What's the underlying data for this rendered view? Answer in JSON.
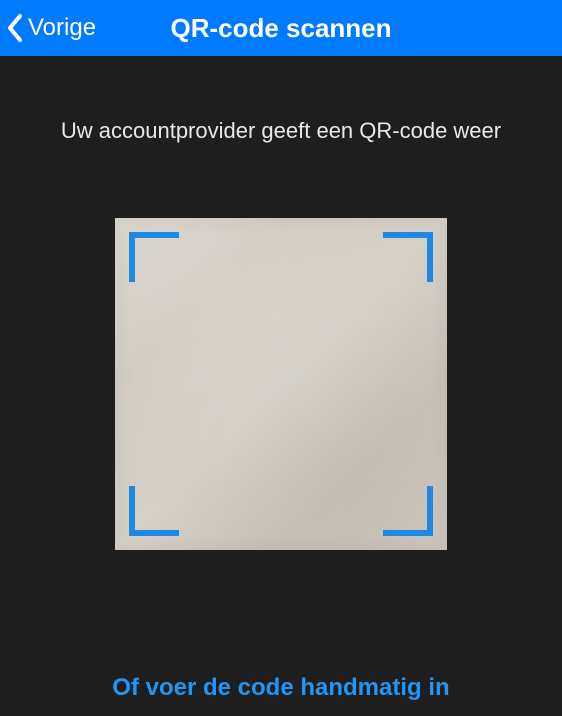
{
  "header": {
    "back_label": "Vorige",
    "title": "QR-code scannen"
  },
  "main": {
    "instruction": "Uw accountprovider geeft een QR-code weer"
  },
  "footer": {
    "manual_link": "Of voer de code handmatig in"
  },
  "colors": {
    "accent": "#007aff",
    "link": "#2196f3"
  }
}
